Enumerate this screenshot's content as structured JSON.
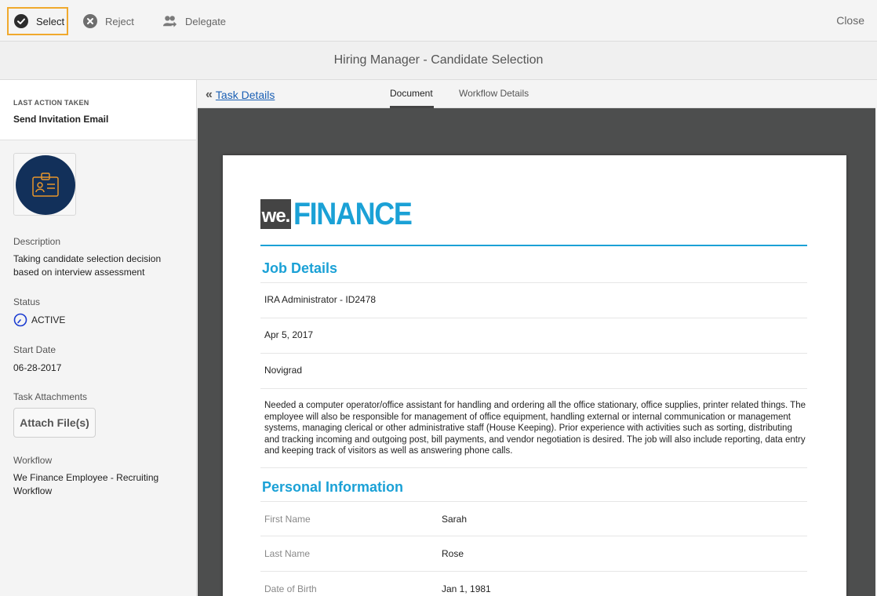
{
  "toolbar": {
    "select_label": "Select",
    "reject_label": "Reject",
    "delegate_label": "Delegate",
    "close_label": "Close"
  },
  "title": "Hiring Manager - Candidate Selection",
  "sidebar": {
    "last_action_label": "LAST ACTION TAKEN",
    "last_action_value": "Send Invitation Email",
    "description_label": "Description",
    "description_value": "Taking candidate selection decision based on interview assessment",
    "status_label": "Status",
    "status_value": "ACTIVE",
    "start_date_label": "Start Date",
    "start_date_value": "06-28-2017",
    "attachments_label": "Task Attachments",
    "attach_button": "Attach File(s)",
    "workflow_label": "Workflow",
    "workflow_value": "We Finance Employee - Recruiting Workflow"
  },
  "tabs": {
    "back_link": "Task Details",
    "document": "Document",
    "workflow_details": "Workflow Details"
  },
  "document": {
    "logo_we": "we.",
    "logo_finance": "FINANCE",
    "job_details_title": "Job Details",
    "job_title": "IRA Administrator - ID2478",
    "job_date": "Apr 5, 2017",
    "job_location": "Novigrad",
    "job_description": "Needed a computer operator/office assistant for handling and ordering all the office stationary, office supplies, printer related things. The employee will also be responsible for management of office equipment, handling external or internal communication or management systems, managing clerical or other administrative staff (House Keeping). Prior experience with activities such as sorting, distributing and tracking incoming and outgoing post, bill payments, and vendor negotiation is desired. The job will also include reporting, data entry and keeping track of visitors as well as answering phone calls.",
    "personal_info_title": "Personal Information",
    "first_name_label": "First Name",
    "first_name_value": "Sarah",
    "last_name_label": "Last Name",
    "last_name_value": "Rose",
    "dob_label": "Date of Birth",
    "dob_value": "Jan 1, 1981"
  },
  "colors": {
    "accent": "#1ba1d6",
    "highlight_border": "#f0a92d",
    "avatar_bg": "#12305a",
    "viewer_bg": "#4d4e4e",
    "link": "#1a5fb4"
  }
}
